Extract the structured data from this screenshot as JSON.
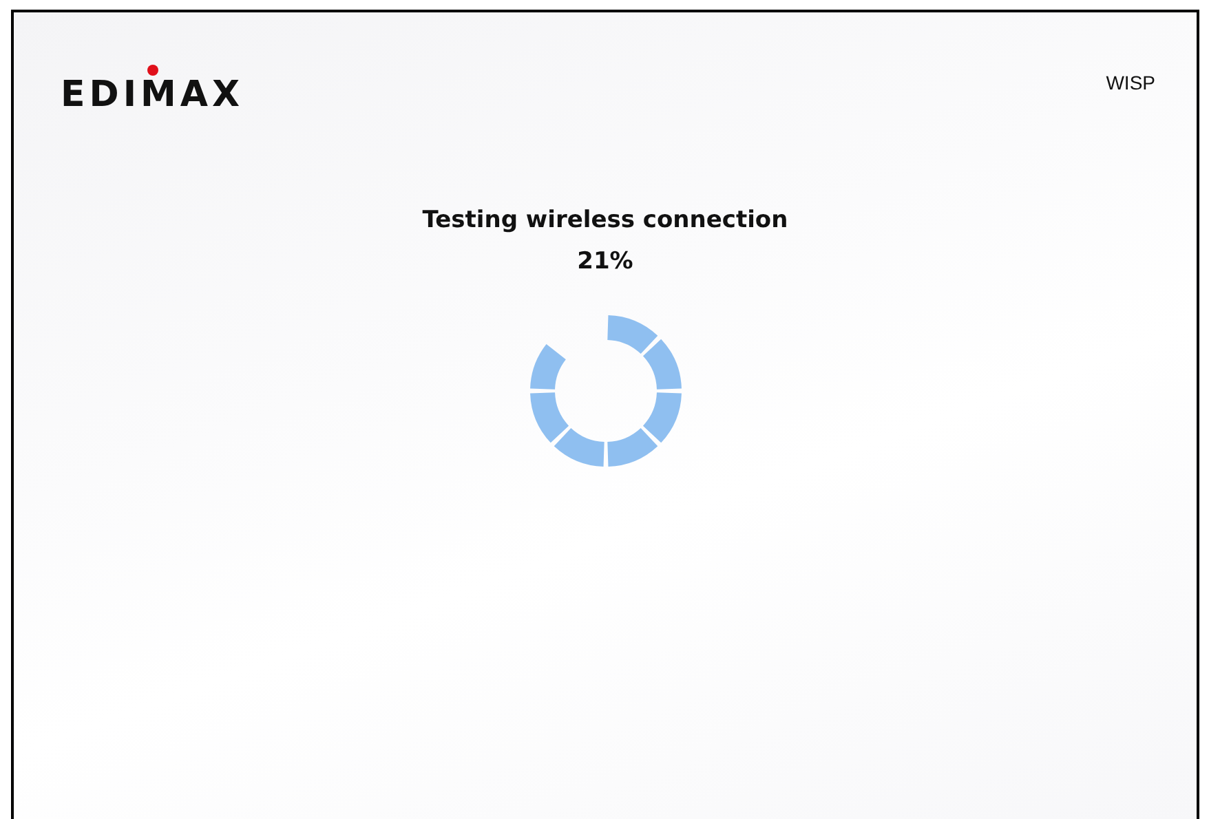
{
  "header": {
    "logo": "EDIMAX",
    "mode": "WISP"
  },
  "status": {
    "message": "Testing wireless connection",
    "progress": "21%"
  }
}
